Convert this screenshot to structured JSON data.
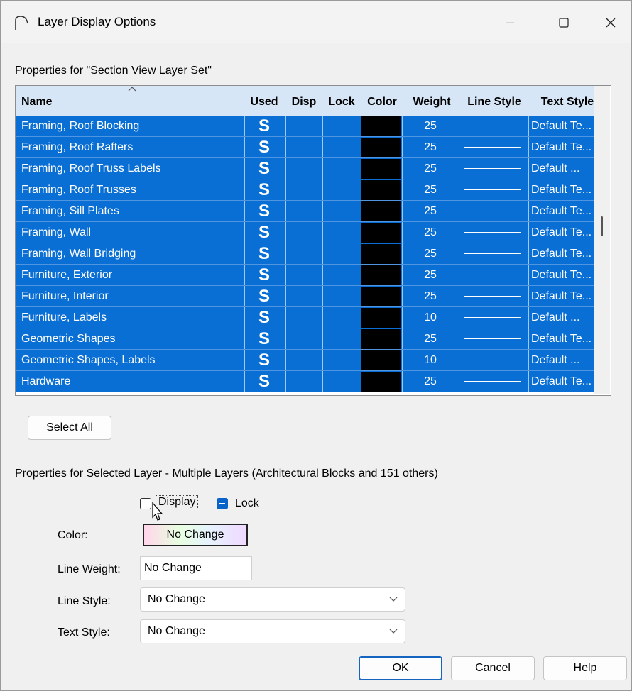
{
  "window": {
    "title": "Layer Display Options"
  },
  "layer_set": {
    "group_label": "Properties for \"Section View Layer Set\"",
    "columns": [
      "Name",
      "Used",
      "Disp",
      "Lock",
      "Color",
      "Weight",
      "Line Style",
      "Text Style"
    ],
    "rows": [
      {
        "name": "Framing, Roof Blocking",
        "used": "S",
        "weight": "25",
        "text_style": "Default Te..."
      },
      {
        "name": "Framing, Roof Rafters",
        "used": "S",
        "weight": "25",
        "text_style": "Default Te..."
      },
      {
        "name": "Framing, Roof Truss Labels",
        "used": "S",
        "weight": "25",
        "text_style": "Default ..."
      },
      {
        "name": "Framing, Roof Trusses",
        "used": "S",
        "weight": "25",
        "text_style": "Default Te..."
      },
      {
        "name": "Framing, Sill Plates",
        "used": "S",
        "weight": "25",
        "text_style": "Default Te..."
      },
      {
        "name": "Framing, Wall",
        "used": "S",
        "weight": "25",
        "text_style": "Default Te..."
      },
      {
        "name": "Framing, Wall Bridging",
        "used": "S",
        "weight": "25",
        "text_style": "Default Te..."
      },
      {
        "name": "Furniture, Exterior",
        "used": "S",
        "weight": "25",
        "text_style": "Default Te..."
      },
      {
        "name": "Furniture, Interior",
        "used": "S",
        "weight": "25",
        "text_style": "Default Te..."
      },
      {
        "name": "Furniture, Labels",
        "used": "S",
        "weight": "10",
        "text_style": "Default ..."
      },
      {
        "name": "Geometric Shapes",
        "used": "S",
        "weight": "25",
        "text_style": "Default Te..."
      },
      {
        "name": "Geometric Shapes, Labels",
        "used": "S",
        "weight": "10",
        "text_style": "Default ..."
      },
      {
        "name": "Hardware",
        "used": "S",
        "weight": "25",
        "text_style": "Default Te..."
      }
    ],
    "select_all_label": "Select All"
  },
  "selected_layer": {
    "group_label": "Properties for Selected Layer - Multiple Layers (Architectural Blocks and 151 others)",
    "display_label": "Display",
    "lock_label": "Lock",
    "color_label": "Color:",
    "color_value": "No Change",
    "line_weight_label": "Line Weight:",
    "line_weight_value": "No Change",
    "line_style_label": "Line Style:",
    "line_style_value": "No Change",
    "text_style_label": "Text Style:",
    "text_style_value": "No Change"
  },
  "buttons": {
    "ok": "OK",
    "cancel": "Cancel",
    "help": "Help"
  },
  "colors": {
    "selection": "#0a6fd4",
    "header": "#d6e6f7",
    "accent": "#0a63c9"
  }
}
